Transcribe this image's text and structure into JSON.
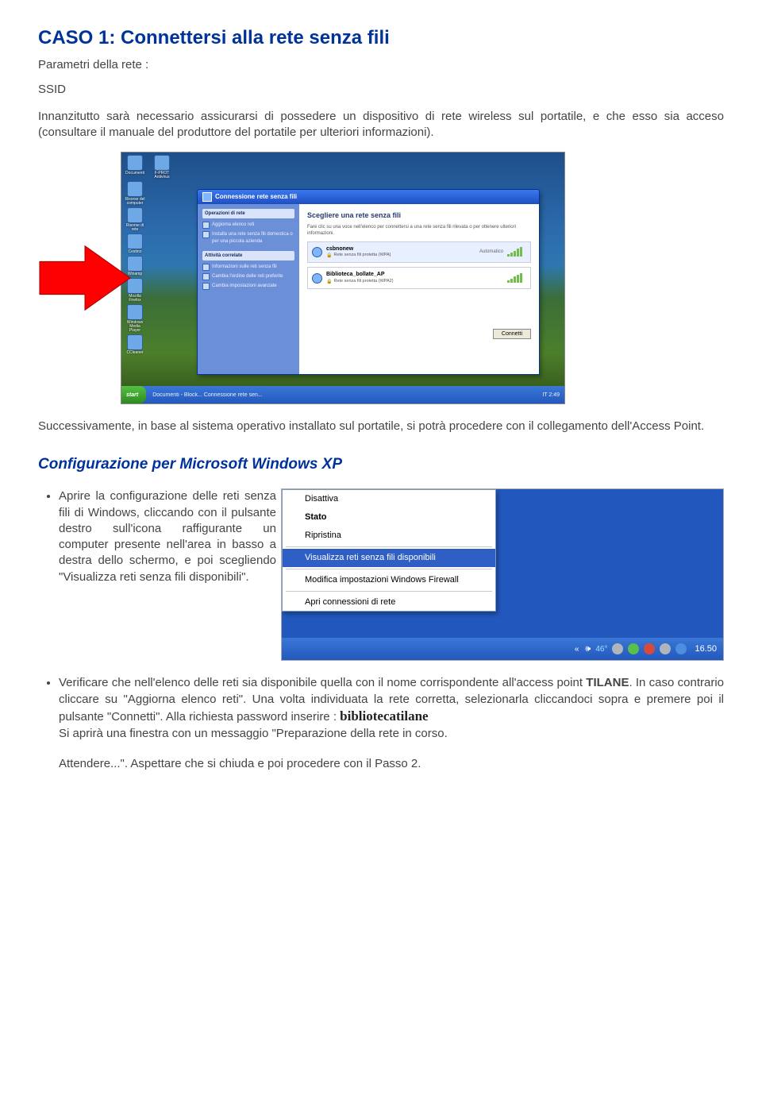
{
  "title": "CASO 1: Connettersi alla rete senza fili",
  "subtitle": "Parametri della rete :",
  "ssid_label": "SSID",
  "intro": "Innanzitutto sarà necessario assicurarsi di possedere un dispositivo di rete wireless sul portatile, e che esso sia acceso (consultare il manuale del produttore del portatile per ulteriori informazioni).",
  "desktop": {
    "window_title": "Connessione rete senza fili",
    "side_header1": "Operazioni di rete",
    "side_links1": [
      "Aggiorna elenco reti",
      "Installa una rete senza fili domestica o per una piccola azienda"
    ],
    "side_header2": "Attività correlate",
    "side_links2": [
      "Informazioni sulle reti senza fili",
      "Cambia l'ordine delle reti preferite",
      "Cambia impostazioni avanzate"
    ],
    "main_title": "Scegliere una rete senza fili",
    "main_desc": "Fare clic su una voce nell'elenco per connettersi a una rete senza fili rilevata o per ottenere ulteriori informazioni.",
    "networks": [
      {
        "name": "csbnonew",
        "sub": "Rete senza fili protetta (WPA)",
        "auto": "Automatico"
      },
      {
        "name": "Biblioteca_bollate_AP",
        "sub": "Rete senza fili protetta (WPA2)",
        "auto": ""
      }
    ],
    "connect_btn": "Connetti",
    "start": "start",
    "taskbar_items": "Documenti - Block...   Connessione rete sen...",
    "tray": "IT   2:49",
    "icons": [
      "Documenti",
      "F-PROT Antivirus",
      "Risorse del computer",
      "Risorse di rete",
      "Cestino",
      "Winamp",
      "Mozilla Firefox",
      "Windows Media Player",
      "CCleaner"
    ]
  },
  "para_after": "Successivamente, in base al sistema operativo installato sul portatile, si potrà procedere con il collegamento dell'Access Point.",
  "config_heading": "Configurazione per Microsoft Windows XP",
  "bullet1": "Aprire la configurazione delle reti senza fili di Windows, cliccando con il pulsante destro sull'icona raffigurante un computer presente nell'area in basso a destra dello schermo, e poi scegliendo \"Visualizza reti senza fili disponibili\".",
  "context_menu": {
    "items_top": [
      "Disattiva",
      "Stato",
      "Ripristina"
    ],
    "highlight": "Visualizza reti senza fili disponibili",
    "items_mid": [
      "Modifica impostazioni Windows Firewall"
    ],
    "items_bot": [
      "Apri connessioni di rete"
    ],
    "temp": "46°",
    "clock": "16.50"
  },
  "bullet2_pre": "Verificare che nell'elenco delle reti sia disponibile quella con il nome corrispondente all'access point ",
  "bullet2_bold": "TILANE",
  "bullet2_post": ". In caso contrario cliccare su \"Aggiorna elenco reti\". Una volta individuata la rete corretta, selezionarla cliccandoci sopra e premere poi il pulsante \"Connetti\". Alla richiesta password inserire : ",
  "bullet2_pw": "bibliotecatilane",
  "bullet2_after": "Si aprirà una finestra con un messaggio \"Preparazione della rete in corso.",
  "bottom": "Attendere...\". Aspettare che si chiuda e poi procedere con il Passo 2."
}
